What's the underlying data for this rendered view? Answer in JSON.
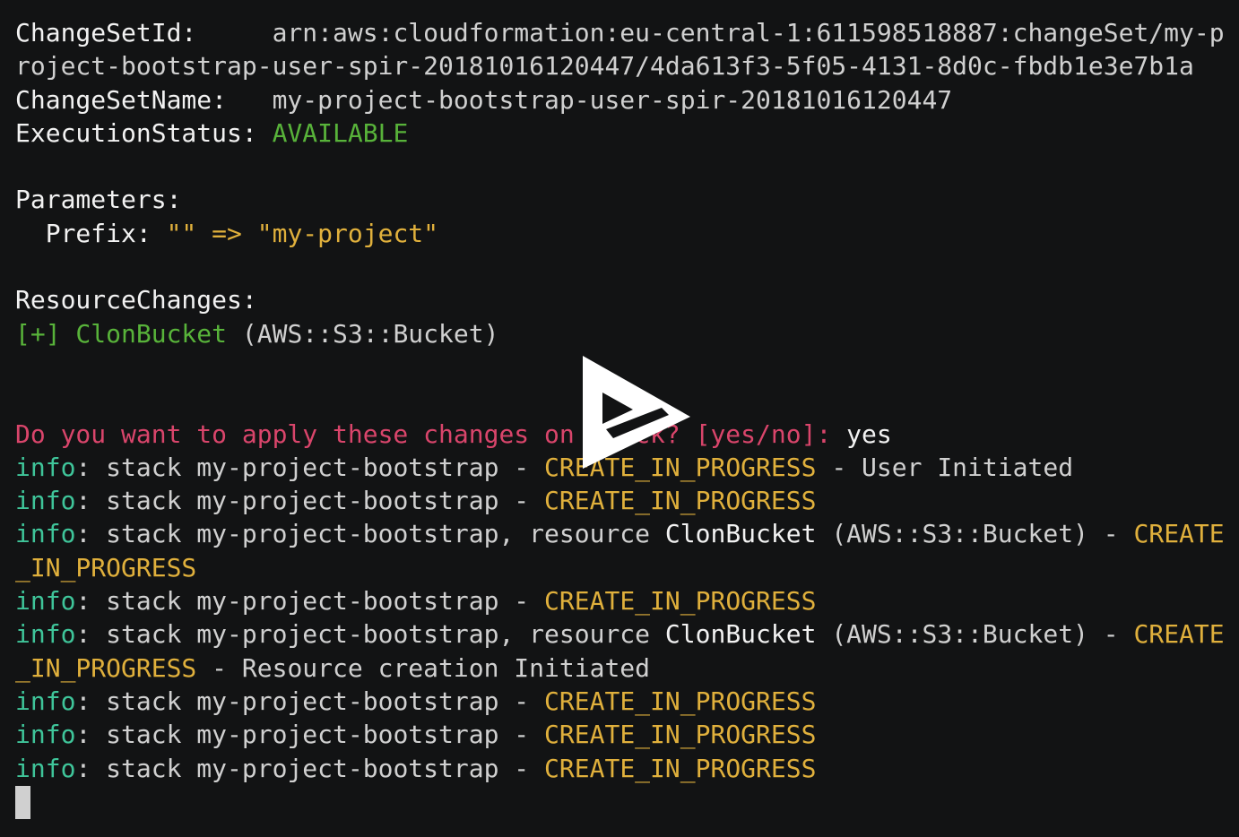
{
  "terminal": {
    "lines": [
      {
        "segments": [
          {
            "text": "ChangeSetId:     ",
            "color": "white"
          },
          {
            "text": "arn:aws:cloudformation:eu-central-1:611598518887:changeSet/my-p",
            "color": "fg"
          }
        ]
      },
      {
        "segments": [
          {
            "text": "roject-bootstrap-user-spir-20181016120447/4da613f3-5f05-4131-8d0c-fbdb1e3e7b1a",
            "color": "fg"
          }
        ]
      },
      {
        "segments": [
          {
            "text": "ChangeSetName:   ",
            "color": "white"
          },
          {
            "text": "my-project-bootstrap-user-spir-20181016120447",
            "color": "fg"
          }
        ]
      },
      {
        "segments": [
          {
            "text": "ExecutionStatus: ",
            "color": "white"
          },
          {
            "text": "AVAILABLE",
            "color": "green"
          }
        ]
      },
      {
        "segments": []
      },
      {
        "segments": [
          {
            "text": "Parameters:",
            "color": "white"
          }
        ]
      },
      {
        "segments": [
          {
            "text": "  Prefix: ",
            "color": "white"
          },
          {
            "text": "\"\" => \"my-project\"",
            "color": "yellow"
          }
        ]
      },
      {
        "segments": []
      },
      {
        "segments": [
          {
            "text": "ResourceChanges:",
            "color": "white"
          }
        ]
      },
      {
        "segments": [
          {
            "text": "[+] ClonBucket ",
            "color": "green"
          },
          {
            "text": "(AWS::S3::Bucket)",
            "color": "fg"
          }
        ]
      },
      {
        "segments": []
      },
      {
        "segments": []
      },
      {
        "segments": [
          {
            "text": "Do you want to apply these changes on stack? [yes/no]: ",
            "color": "red"
          },
          {
            "text": "yes",
            "color": "white"
          }
        ]
      },
      {
        "segments": [
          {
            "text": "info",
            "color": "teal"
          },
          {
            "text": ": stack my-project-bootstrap - ",
            "color": "fg"
          },
          {
            "text": "CREATE_IN_PROGRESS",
            "color": "yellow"
          },
          {
            "text": " - User Initiated",
            "color": "fg"
          }
        ]
      },
      {
        "segments": [
          {
            "text": "info",
            "color": "teal"
          },
          {
            "text": ": stack my-project-bootstrap - ",
            "color": "fg"
          },
          {
            "text": "CREATE_IN_PROGRESS",
            "color": "yellow"
          }
        ]
      },
      {
        "segments": [
          {
            "text": "info",
            "color": "teal"
          },
          {
            "text": ": stack my-project-bootstrap, resource ",
            "color": "fg"
          },
          {
            "text": "ClonBucket",
            "color": "white"
          },
          {
            "text": " (AWS::S3::Bucket) - ",
            "color": "fg"
          },
          {
            "text": "CREATE",
            "color": "yellow"
          }
        ]
      },
      {
        "segments": [
          {
            "text": "_IN_PROGRESS",
            "color": "yellow"
          }
        ]
      },
      {
        "segments": [
          {
            "text": "info",
            "color": "teal"
          },
          {
            "text": ": stack my-project-bootstrap - ",
            "color": "fg"
          },
          {
            "text": "CREATE_IN_PROGRESS",
            "color": "yellow"
          }
        ]
      },
      {
        "segments": [
          {
            "text": "info",
            "color": "teal"
          },
          {
            "text": ": stack my-project-bootstrap, resource ",
            "color": "fg"
          },
          {
            "text": "ClonBucket",
            "color": "white"
          },
          {
            "text": " (AWS::S3::Bucket) - ",
            "color": "fg"
          },
          {
            "text": "CREATE",
            "color": "yellow"
          }
        ]
      },
      {
        "segments": [
          {
            "text": "_IN_PROGRESS",
            "color": "yellow"
          },
          {
            "text": " - Resource creation Initiated",
            "color": "fg"
          }
        ]
      },
      {
        "segments": [
          {
            "text": "info",
            "color": "teal"
          },
          {
            "text": ": stack my-project-bootstrap - ",
            "color": "fg"
          },
          {
            "text": "CREATE_IN_PROGRESS",
            "color": "yellow"
          }
        ]
      },
      {
        "segments": [
          {
            "text": "info",
            "color": "teal"
          },
          {
            "text": ": stack my-project-bootstrap - ",
            "color": "fg"
          },
          {
            "text": "CREATE_IN_PROGRESS",
            "color": "yellow"
          }
        ]
      },
      {
        "segments": [
          {
            "text": "info",
            "color": "teal"
          },
          {
            "text": ": stack my-project-bootstrap - ",
            "color": "fg"
          },
          {
            "text": "CREATE_IN_PROGRESS",
            "color": "yellow"
          }
        ]
      }
    ]
  },
  "overlay": {
    "icon": "asciinema-play-icon"
  },
  "colors": {
    "background": "#121314",
    "foreground": "#d0d0d0",
    "green": "#58b33a",
    "yellow": "#e0b03c",
    "red": "#d9456b",
    "teal": "#3fc59a"
  }
}
